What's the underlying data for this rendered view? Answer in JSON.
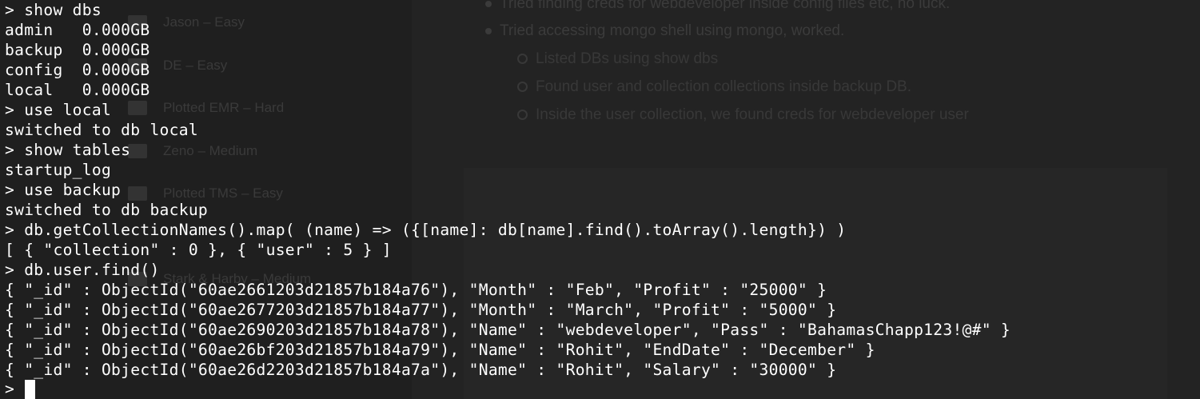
{
  "background_window": {
    "sidebar_items": [
      {
        "label": "Jason – Easy"
      },
      {
        "label": "DE – Easy"
      },
      {
        "label": "Plotted EMR – Hard"
      },
      {
        "label": "Zeno – Medium"
      },
      {
        "label": "Plotted TMS – Easy"
      },
      {
        "label": "Stark & Harby – Medium"
      }
    ],
    "notes": [
      {
        "text": "Tried finding creds for webdeveloper inside config files etc, no luck."
      },
      {
        "text": "Tried accessing mongo shell using mongo, worked."
      }
    ],
    "sub_notes": [
      {
        "text": "Listed DBs using show dbs"
      },
      {
        "text": "Found user and collection collections inside backup DB."
      },
      {
        "text": "Inside the user collection, we found creds for webdeveloper user"
      }
    ]
  },
  "terminal": {
    "lines": [
      "> show dbs",
      "admin   0.000GB",
      "backup  0.000GB",
      "config  0.000GB",
      "local   0.000GB",
      "> use local",
      "switched to db local",
      "> show tables",
      "startup_log",
      "> use backup",
      "switched to db backup",
      "> db.getCollectionNames().map( (name) => ({[name]: db[name].find().toArray().length}) )",
      "[ { \"collection\" : 0 }, { \"user\" : 5 } ]",
      "> db.user.find()",
      "{ \"_id\" : ObjectId(\"60ae2661203d21857b184a76\"), \"Month\" : \"Feb\", \"Profit\" : \"25000\" }",
      "{ \"_id\" : ObjectId(\"60ae2677203d21857b184a77\"), \"Month\" : \"March\", \"Profit\" : \"5000\" }",
      "{ \"_id\" : ObjectId(\"60ae2690203d21857b184a78\"), \"Name\" : \"webdeveloper\", \"Pass\" : \"BahamasChapp123!@#\" }",
      "{ \"_id\" : ObjectId(\"60ae26bf203d21857b184a79\"), \"Name\" : \"Rohit\", \"EndDate\" : \"December\" }",
      "{ \"_id\" : ObjectId(\"60ae26d2203d21857b184a7a\"), \"Name\" : \"Rohit\", \"Salary\" : \"30000\" }",
      ">"
    ]
  }
}
